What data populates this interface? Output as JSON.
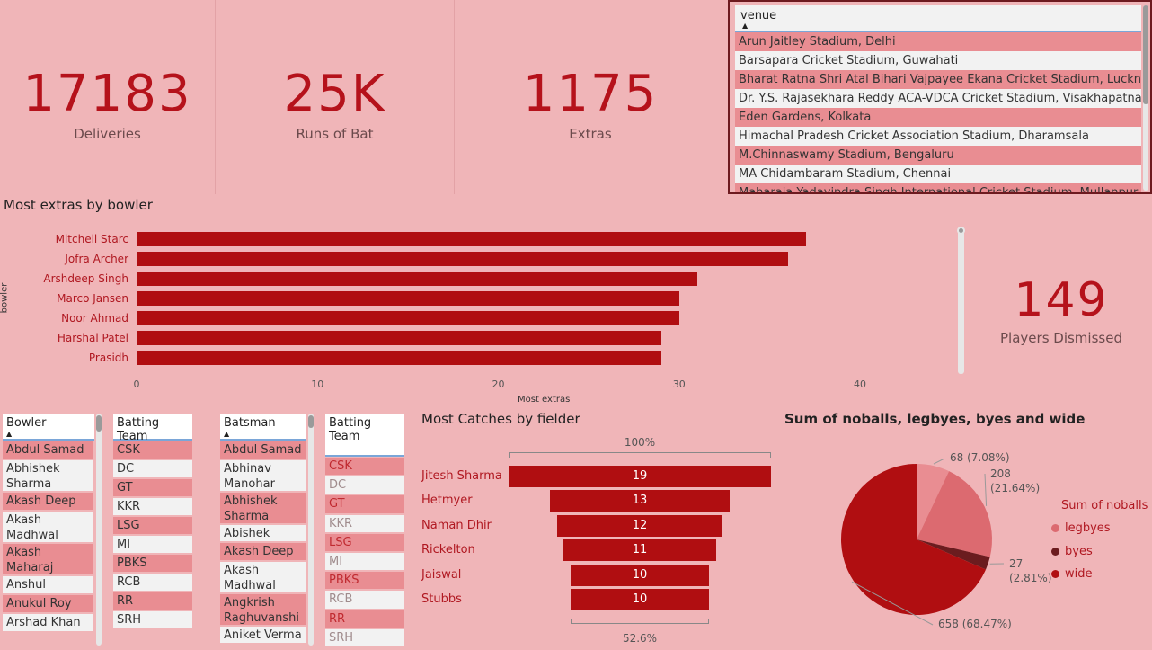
{
  "kpis": [
    {
      "value": "17183",
      "label": "Deliveries"
    },
    {
      "value": "25K",
      "label": "Runs of Bat"
    },
    {
      "value": "1175",
      "label": "Extras"
    },
    {
      "value": "149",
      "label": "Players Dismissed"
    }
  ],
  "venue_slicer": {
    "header": "venue",
    "items": [
      "Arun Jaitley Stadium, Delhi",
      "Barsapara Cricket Stadium, Guwahati",
      "Bharat Ratna Shri Atal Bihari Vajpayee Ekana Cricket Stadium, Lucknow",
      "Dr. Y.S. Rajasekhara Reddy ACA-VDCA Cricket Stadium, Visakhapatnam",
      "Eden Gardens, Kolkata",
      "Himachal Pradesh Cricket Association Stadium, Dharamsala",
      "M.Chinnaswamy Stadium, Bengaluru",
      "MA Chidambaram Stadium, Chennai",
      "Maharaja Yadavindra Singh International Cricket Stadium, Mullanpur"
    ],
    "selected": [
      true,
      false,
      true,
      false,
      true,
      false,
      true,
      false,
      true
    ]
  },
  "chart_data": [
    {
      "type": "bar",
      "orientation": "horizontal",
      "title": "Most extras by bowler",
      "xlabel": "Most extras",
      "ylabel": "bowler",
      "categories": [
        "Mitchell Starc",
        "Jofra Archer",
        "Arshdeep Singh",
        "Marco Jansen",
        "Noor Ahmad",
        "Harshal Patel",
        "Prasidh"
      ],
      "values": [
        37,
        36,
        31,
        30,
        30,
        29,
        29
      ],
      "xlim": [
        0,
        45
      ],
      "xticks": [
        "0",
        "10",
        "20",
        "30",
        "40"
      ],
      "color": "#b00e11"
    },
    {
      "type": "bar",
      "orientation": "funnel",
      "title": "Most Catches by fielder",
      "categories": [
        "Jitesh Sharma",
        "Hetmyer",
        "Naman Dhir",
        "Rickelton",
        "Jaiswal",
        "Stubbs"
      ],
      "values": [
        19,
        13,
        12,
        11,
        10,
        10
      ],
      "top_pct": "100%",
      "bottom_pct": "52.6%",
      "color": "#b00e11"
    },
    {
      "type": "pie",
      "title": "Sum of noballs, legbyes, byes and wide",
      "legend_title": "Sum of noballs",
      "legend_position": "right",
      "slices": [
        {
          "name": "noballs",
          "value": 68,
          "label": "68 (7.08%)",
          "color": "#e98d92"
        },
        {
          "name": "legbyes",
          "value": 208,
          "label": "208 (21.64%)",
          "color": "#dc6a70"
        },
        {
          "name": "byes",
          "value": 27,
          "label": "27 (2.81%)",
          "color": "#6b1c1f"
        },
        {
          "name": "wide",
          "value": 658,
          "label": "658 (68.47%)",
          "color": "#b00e11"
        }
      ],
      "legend_entries": [
        {
          "label": "legbyes",
          "color": "#dc6a70"
        },
        {
          "label": "byes",
          "color": "#6b1c1f"
        },
        {
          "label": "wide",
          "color": "#b00e11"
        }
      ]
    }
  ],
  "bowler_slicer": {
    "header": "Bowler",
    "items": [
      "Abdul Samad",
      "Abhishek Sharma",
      "Akash Deep",
      "Akash Madhwal",
      "Akash Maharaj Singh",
      "Anshul Kamboj",
      "Anukul Roy",
      "Arshad Khan"
    ]
  },
  "batting_team_slicer_1": {
    "header": "Batting Team",
    "items": [
      "CSK",
      "DC",
      "GT",
      "KKR",
      "LSG",
      "MI",
      "PBKS",
      "RCB",
      "RR",
      "SRH"
    ]
  },
  "batsman_slicer": {
    "header": "Batsman",
    "items": [
      "Abdul Samad",
      "Abhinav Manohar",
      "Abhishek Sharma",
      "Abishek Porel",
      "Akash Deep",
      "Akash Madhwal",
      "Angkrish Raghuvanshi",
      "Aniket Verma"
    ]
  },
  "batting_team_slicer_2": {
    "header": "Batting Team",
    "items": [
      "CSK",
      "DC",
      "GT",
      "KKR",
      "LSG",
      "MI",
      "PBKS",
      "RCB",
      "RR",
      "SRH"
    ]
  }
}
